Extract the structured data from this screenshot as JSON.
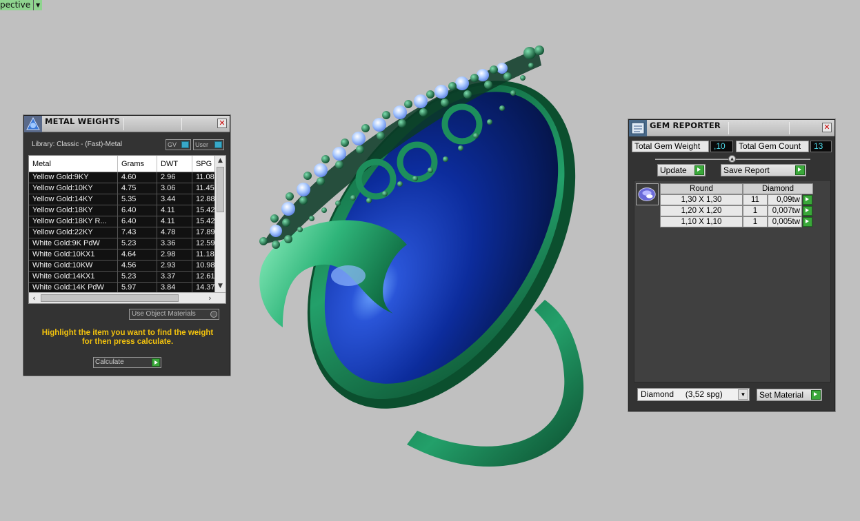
{
  "viewport": {
    "label": "pective"
  },
  "metal_panel": {
    "title": "METAL WEIGHTS",
    "library": "Library: Classic - (Fast)-Metal",
    "toggle_gv": "GV",
    "toggle_user": "User",
    "columns": [
      "Metal",
      "Grams",
      "DWT",
      "SPG"
    ],
    "rows": [
      [
        "Yellow Gold:9KY",
        "4.60",
        "2.96",
        "11.08"
      ],
      [
        "Yellow Gold:10KY",
        "4.75",
        "3.06",
        "11.45"
      ],
      [
        "Yellow Gold:14KY",
        "5.35",
        "3.44",
        "12.88"
      ],
      [
        "Yellow Gold:18KY",
        "6.40",
        "4.11",
        "15.42"
      ],
      [
        "Yellow Gold:18KY R...",
        "6.40",
        "4.11",
        "15.42"
      ],
      [
        "Yellow Gold:22KY",
        "7.43",
        "4.78",
        "17.89"
      ],
      [
        "White Gold:9K PdW",
        "5.23",
        "3.36",
        "12.59"
      ],
      [
        "White Gold:10KX1",
        "4.64",
        "2.98",
        "11.18"
      ],
      [
        "White Gold:10KW",
        "4.56",
        "2.93",
        "10.98"
      ],
      [
        "White Gold:14KX1",
        "5.23",
        "3.37",
        "12.61"
      ],
      [
        "White Gold:14K PdW",
        "5.97",
        "3.84",
        "14.37"
      ]
    ],
    "use_object_materials": "Use Object Materials",
    "hint_line1": "Highlight the item you want to find the weight",
    "hint_line2": "for then press calculate.",
    "calculate": "Calculate"
  },
  "gem_panel": {
    "title": "GEM REPORTER",
    "total_weight_label": "Total Gem Weight",
    "total_weight_value": ",10",
    "total_count_label": "Total Gem Count",
    "total_count_value": "13",
    "update": "Update",
    "save_report": "Save Report",
    "header_shape": "Round",
    "header_material": "Diamond",
    "rows": [
      [
        "1,30 X 1,30",
        "11",
        "0,09tw"
      ],
      [
        "1,20 X 1,20",
        "1",
        "0,007tw"
      ],
      [
        "1,10 X 1,10",
        "1",
        "0,005tw"
      ]
    ],
    "material_select": "Diamond     (3,52 spg)",
    "set_material": "Set Material"
  },
  "colors": {
    "background": "#c0c0c0",
    "metal_green": "#1f8f5a",
    "gem_blue": "#0a2a9a",
    "hint_yellow": "#f2c20e",
    "stat_cyan": "#4fd8e8"
  }
}
